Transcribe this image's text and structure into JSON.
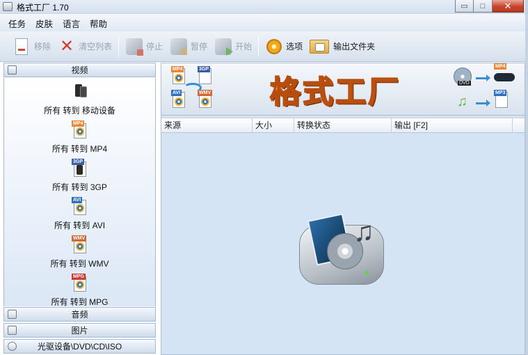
{
  "window": {
    "title": "格式工厂 1.70",
    "buttons": {
      "minimize": "▭",
      "maximize": "□",
      "close": "✕"
    }
  },
  "menu": [
    "任务",
    "皮肤",
    "语言",
    "帮助"
  ],
  "toolbar": {
    "remove": "移除",
    "clear_list": "清空列表",
    "stop": "停止",
    "pause": "暂停",
    "start": "开始",
    "options": "选项",
    "output_folder": "输出文件夹"
  },
  "sidebar": {
    "video": "视频",
    "audio": "音频",
    "image": "图片",
    "rom": "光驱设备\\DVD\\CD\\ISO",
    "items": [
      {
        "label": "所有 转到 移动设备",
        "icon": "mobile-device-icon"
      },
      {
        "label": "所有 转到 MP4",
        "tag": "MP4",
        "color": "#e8883a"
      },
      {
        "label": "所有 转到 3GP",
        "tag": "3GP",
        "color": "#3a5fa8"
      },
      {
        "label": "所有 转到 AVI",
        "tag": "AVI",
        "color": "#2f6fc0"
      },
      {
        "label": "所有 转到 WMV",
        "tag": "WMV",
        "color": "#d06a3a"
      },
      {
        "label": "所有 转到 MPG",
        "tag": "MPG",
        "color": "#c83a3a"
      }
    ]
  },
  "banner": {
    "title": "格式工厂",
    "left_tags": [
      "MP4",
      "3GP",
      "AVI",
      "WMV"
    ],
    "right_tags": [
      "DVD",
      "MP4",
      "MP3"
    ]
  },
  "table": {
    "columns": [
      "来源",
      "大小",
      "转换状态",
      "输出 [F2]"
    ]
  }
}
